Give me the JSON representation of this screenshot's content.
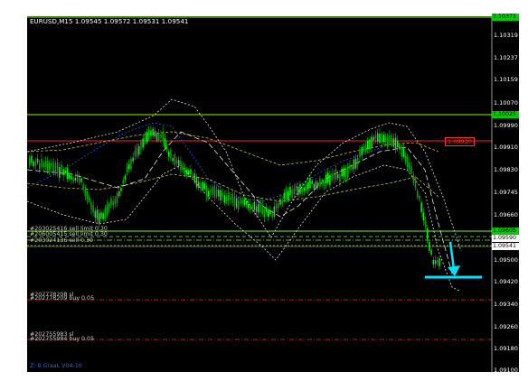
{
  "chart": {
    "title": "EURUSD,M15  1.09545 1.09572 1.09531 1.09541",
    "indicator_label": "Z: 8 GraaL V04-10",
    "red_level_label": "1.09930",
    "price_scale": [
      "1.10319",
      "1.10237",
      "1.10159",
      "1.10070",
      "1.09990",
      "1.09910",
      "1.09830",
      "1.09745",
      "1.09660",
      "1.09580",
      "1.09541",
      "1.09500",
      "1.09420",
      "1.09340",
      "1.09260",
      "1.09180",
      "1.09100"
    ],
    "price_tags": [
      {
        "label": "1.10371",
        "bg": "#00cc00",
        "color": "#000000"
      },
      {
        "label": "1.10025",
        "bg": "#00cc00",
        "color": "#000000"
      },
      {
        "label": "1.09605",
        "bg": "#00cc00",
        "color": "#000000"
      },
      {
        "label": "1.09590",
        "bg": "#ffffff",
        "color": "#000000"
      },
      {
        "label": "1.09541",
        "bg": "#ffffff",
        "color": "#000000"
      }
    ],
    "orders": [
      "#203025416 sell limit 0.30",
      "#206005415 sell limit 0.30",
      "#203024136 sell 0.30",
      "#202778208 sl",
      "#202778209 buy 0.05",
      "#202755983 sl",
      "#202755984 buy 0.05"
    ],
    "colors": {
      "background": "#000000",
      "candle_up": "#00ff00",
      "candle_down": "#00aa00",
      "green_level": "#7cfc00",
      "red_level": "#ff2020",
      "arrow": "#00e5ff",
      "band_outer": "#e0e0e0",
      "band_yellow": "#c8c800",
      "band_blue": "#3050ff"
    }
  }
}
